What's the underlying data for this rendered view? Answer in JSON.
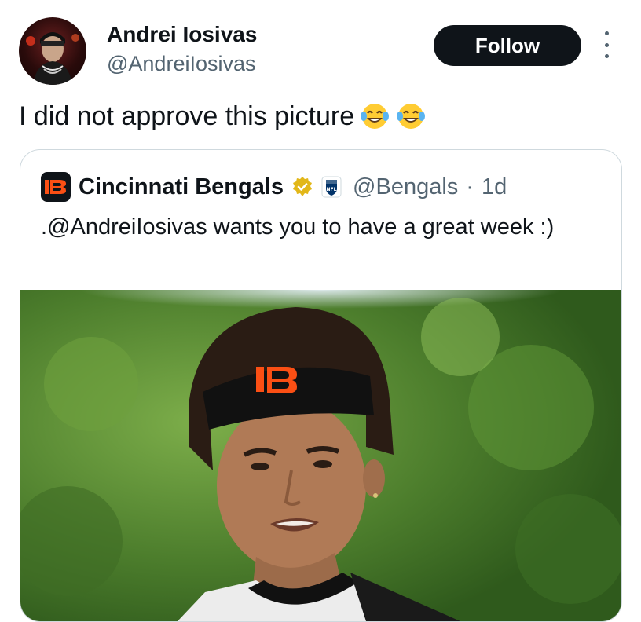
{
  "author": {
    "display_name": "Andrei Iosivas",
    "handle": "@AndreiIosivas",
    "avatar_icon": "profile-photo-avatar"
  },
  "follow_label": "Follow",
  "more_icon": "more-options-vertical-icon",
  "tweet": {
    "text": "I did not approve this picture",
    "emoji_icon": "face-with-tears-of-joy"
  },
  "quoted": {
    "display_name": "Cincinnati Bengals",
    "handle": "@Bengals",
    "separator": "·",
    "time_ago": "1d",
    "logo_icon": "bengals-b-logo",
    "verified_icon": "gold-verified-badge",
    "affiliate_icon": "nfl-shield-badge",
    "text": ".@AndreiIosivas wants you to have a great week :)",
    "photo_icon": "player-portrait-photo"
  },
  "colors": {
    "text_primary": "#0f1419",
    "text_secondary": "#536471",
    "border": "#cfd9de",
    "follow_bg": "#0f1419",
    "bengals_orange": "#fb4f14",
    "verified_gold": "#e2b719"
  }
}
